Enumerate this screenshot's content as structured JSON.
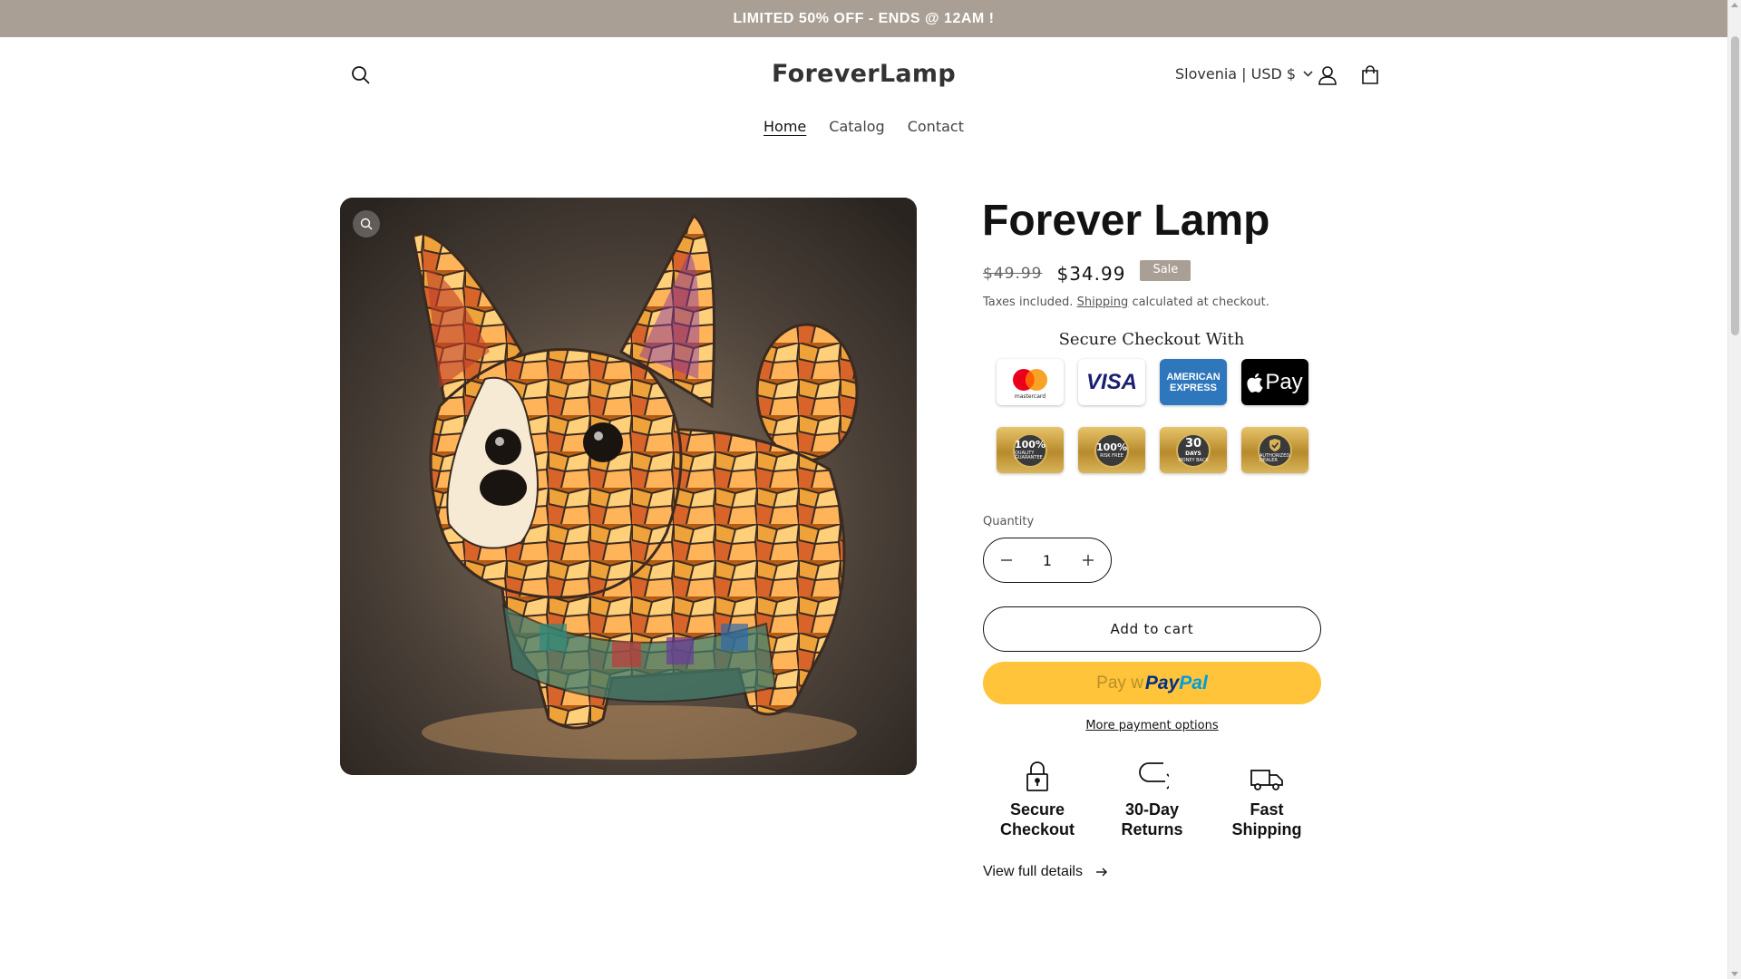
{
  "announcement": {
    "text": "LIMITED 50% OFF - ENDS @ 12AM !"
  },
  "header": {
    "logo": "ForeverLamp",
    "locale": "Slovenia | USD $"
  },
  "nav": {
    "items": [
      {
        "label": "Home"
      },
      {
        "label": "Catalog"
      },
      {
        "label": "Contact"
      }
    ]
  },
  "product": {
    "title": "Forever Lamp",
    "old_price": "$49.99",
    "price": "$34.99",
    "sale_badge": "Sale",
    "tax_prefix": "Taxes included.",
    "tax_link": "Shipping",
    "tax_suffix": "calculated at checkout.",
    "secure_title": "Secure Checkout With",
    "payment_methods": [
      "mastercard",
      "VISA",
      "AMERICAN EXPRESS",
      "Pay"
    ],
    "trust_badges": [
      {
        "value": "100%",
        "caption": "QUALITY GUARANTEE"
      },
      {
        "value": "100%",
        "caption": "RISK FREE"
      },
      {
        "value": "30",
        "sub": "DAYS",
        "caption": "MONEY BACK"
      },
      {
        "value": "",
        "caption": "AUTHORIZED DEALER"
      }
    ],
    "quantity_label": "Quantity",
    "quantity": "1",
    "add_to_cart": "Add to cart",
    "paypal_prefix": "Pay w",
    "paypal_brand_1": "Pay",
    "paypal_brand_2": "Pal",
    "more_payment": "More payment options",
    "features": [
      {
        "icon": "lock-icon",
        "line1": "Secure",
        "line2": "Checkout"
      },
      {
        "icon": "return-arrow-icon",
        "line1": "30-Day",
        "line2": "Returns"
      },
      {
        "icon": "truck-icon",
        "line1": "Fast",
        "line2": "Shipping"
      }
    ],
    "view_details": "View full details"
  },
  "colors": {
    "announcement_bg": "#a99f94",
    "sale_badge": "#a99f94",
    "paypal_yellow": "#ffc439",
    "paypal_dark": "#003087",
    "paypal_light": "#009cde"
  }
}
